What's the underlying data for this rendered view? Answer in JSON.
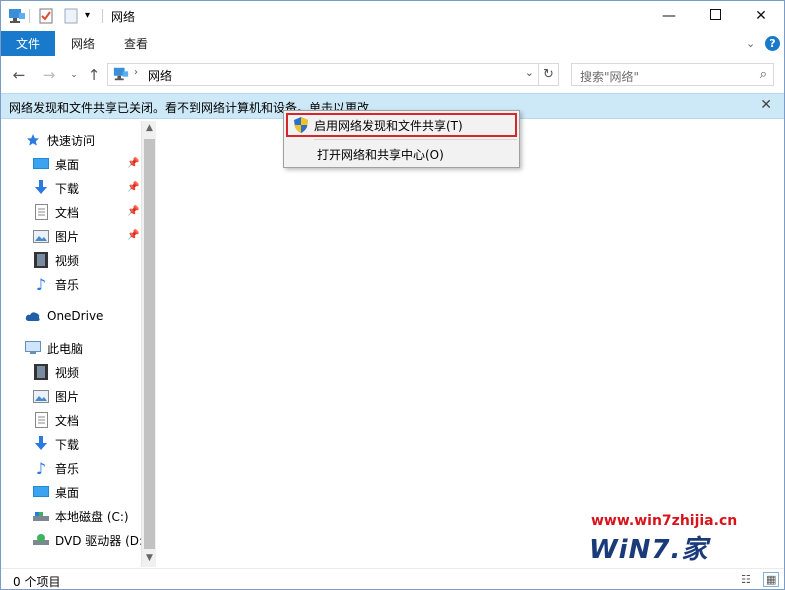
{
  "window": {
    "title": "网络",
    "controls": [
      "minimize-icon",
      "maximize-icon",
      "close-icon"
    ]
  },
  "ribbon": {
    "tabs": [
      {
        "label": "文件",
        "active": true
      },
      {
        "label": "网络"
      },
      {
        "label": "查看"
      }
    ]
  },
  "navigation": {
    "address": "网络",
    "search_placeholder": "搜索\"网络\""
  },
  "infobar": {
    "message": "网络发现和文件共享已关闭。看不到网络计算机和设备。单击以更改..."
  },
  "context_menu": {
    "items": [
      {
        "label": "启用网络发现和文件共享(T)",
        "icon": "shield-icon",
        "highlighted": true
      },
      {
        "label": "打开网络和共享中心(O)"
      }
    ]
  },
  "nav_pane": {
    "quick_access": {
      "label": "快速访问",
      "items": [
        {
          "label": "桌面",
          "icon": "desktop-icon",
          "pinned": true
        },
        {
          "label": "下载",
          "icon": "download-icon",
          "pinned": true
        },
        {
          "label": "文档",
          "icon": "document-icon",
          "pinned": true
        },
        {
          "label": "图片",
          "icon": "picture-icon",
          "pinned": true
        },
        {
          "label": "视频",
          "icon": "video-icon"
        },
        {
          "label": "音乐",
          "icon": "music-icon"
        }
      ]
    },
    "onedrive": {
      "label": "OneDrive"
    },
    "this_pc": {
      "label": "此电脑",
      "items": [
        {
          "label": "视频",
          "icon": "video-icon"
        },
        {
          "label": "图片",
          "icon": "picture-icon"
        },
        {
          "label": "文档",
          "icon": "document-icon"
        },
        {
          "label": "下载",
          "icon": "download-icon"
        },
        {
          "label": "音乐",
          "icon": "music-icon"
        },
        {
          "label": "桌面",
          "icon": "desktop-icon"
        },
        {
          "label": "本地磁盘 (C:)",
          "icon": "drive-icon"
        },
        {
          "label": "DVD 驱动器 (D:",
          "icon": "dvd-icon"
        }
      ]
    }
  },
  "status": {
    "item_count": "0 个项目"
  },
  "watermark": {
    "url": "www.win7zhijia.cn",
    "logo": "WiN7.",
    "logo_ji": "家"
  },
  "colors": {
    "file_tab": "#1979ca",
    "infobar": "#cde8f7",
    "highlight_border": "#d7262a"
  }
}
